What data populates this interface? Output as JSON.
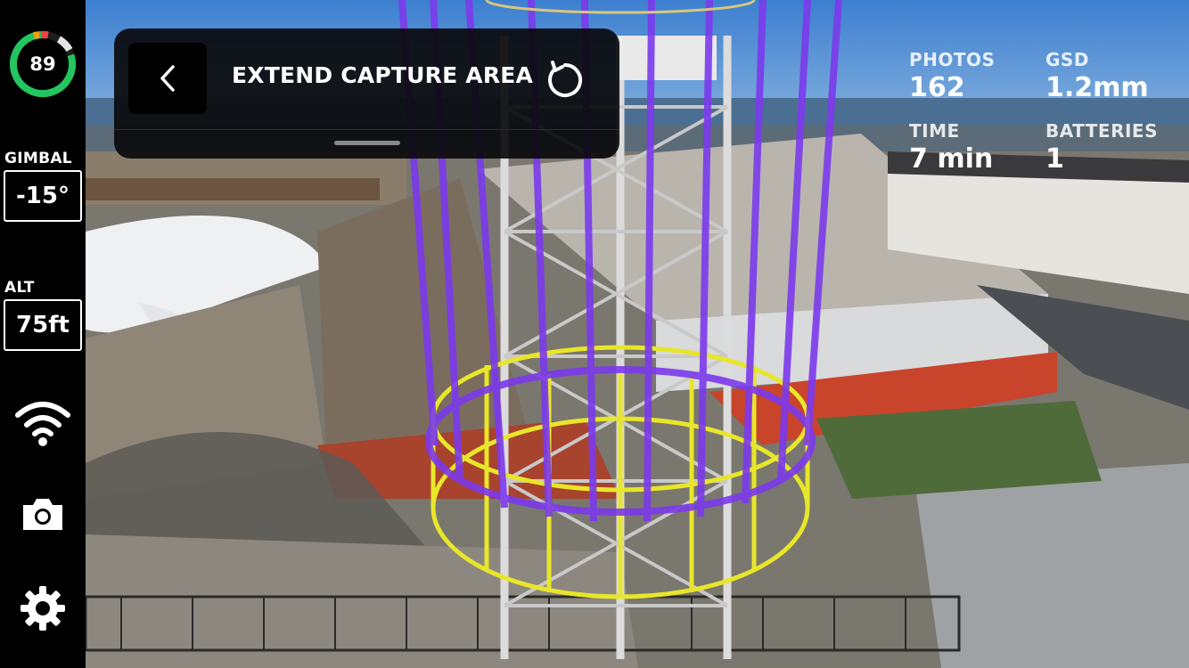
{
  "sidebar": {
    "battery_value": "89",
    "gimbal_label": "GIMBAL",
    "gimbal_value": "-15°",
    "alt_label": "ALT",
    "alt_value": "75ft",
    "icons": [
      "wifi-icon",
      "camera-icon",
      "gear-icon"
    ]
  },
  "overlay": {
    "title": "EXTEND CAPTURE AREA",
    "back_icon": "chevron-left-icon",
    "reset_icon": "refresh-icon"
  },
  "stats": {
    "photos_label": "PHOTOS",
    "photos_value": "162",
    "gsd_label": "GSD",
    "gsd_value": "1.2mm",
    "time_label": "TIME",
    "time_value": "7 min",
    "batteries_label": "BATTERIES",
    "batteries_value": "1"
  },
  "colors": {
    "battery_green": "#22c55e",
    "capture_purple": "#7c3aed",
    "capture_yellow": "#e8e62a"
  }
}
